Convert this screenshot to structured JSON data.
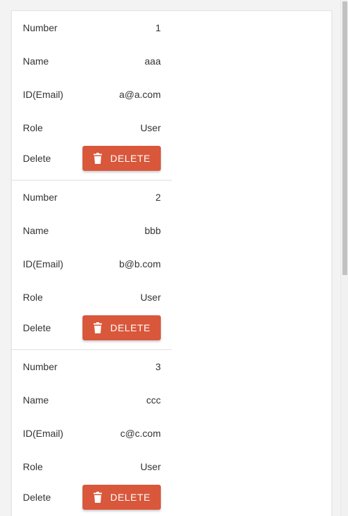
{
  "labels": {
    "number": "Number",
    "name": "Name",
    "email": "ID(Email)",
    "role": "Role",
    "delete": "Delete"
  },
  "button": {
    "delete_label": "DELETE",
    "icon": "trash-icon",
    "color": "#d9573b"
  },
  "records": [
    {
      "number": "1",
      "name": "aaa",
      "email": "a@a.com",
      "role": "User"
    },
    {
      "number": "2",
      "name": "bbb",
      "email": "b@b.com",
      "role": "User"
    },
    {
      "number": "3",
      "name": "ccc",
      "email": "c@c.com",
      "role": "User"
    }
  ]
}
